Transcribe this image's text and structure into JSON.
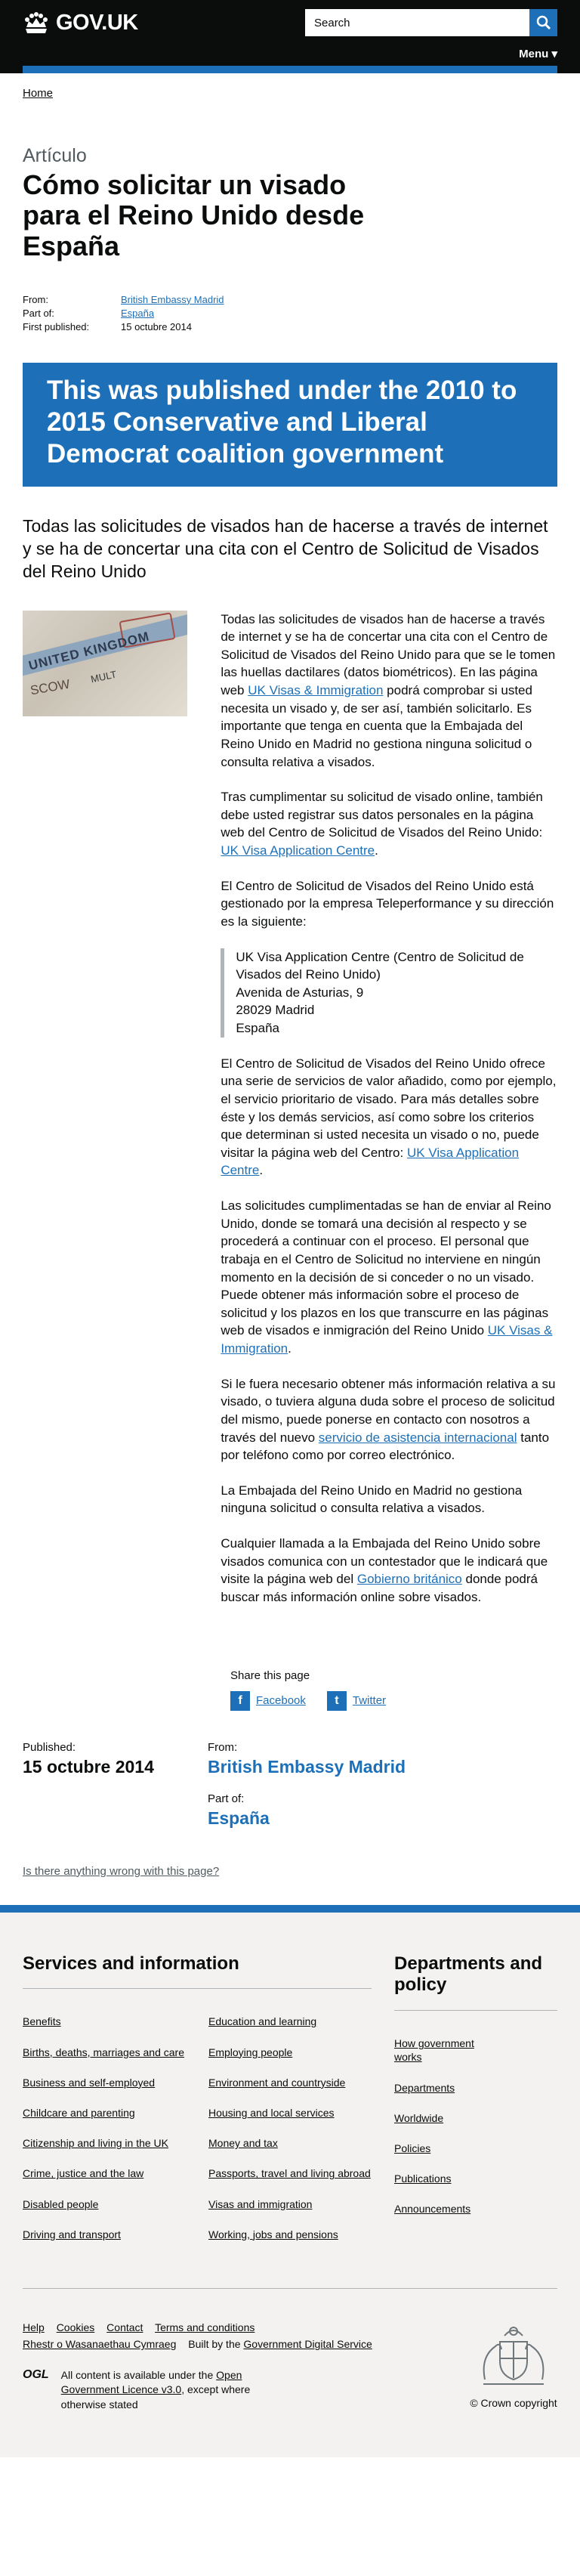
{
  "header": {
    "logo_text": "GOV.UK",
    "search_placeholder": "Search",
    "menu_label": "Menu ▾"
  },
  "breadcrumb": {
    "home": "Home"
  },
  "article": {
    "doc_type": "Artículo",
    "title": "Cómo solicitar un visado para el Reino Unido desde España",
    "meta": {
      "from_label": "From:",
      "from_value": "British Embassy Madrid",
      "partof_label": "Part of:",
      "partof_value": "España",
      "first_label": "First published:",
      "first_value": "15 octubre 2014"
    },
    "history_banner": "This was published under the 2010 to 2015 Conservative and Liberal Democrat coalition government",
    "lede": "Todas las solicitudes de visados han de hacerse a través de internet y se ha de concertar una cita con el Centro de Solicitud de Visados del Reino Unido",
    "image": {
      "line1": "UNITED KINGDOM",
      "line2": "MULT",
      "line3": "SCOW"
    },
    "p1_pre": "Todas las solicitudes de visados han de hacerse a través de internet y se ha de concertar una cita con el Centro de Solicitud de Visados del Reino Unido para que se le tomen las huellas dactilares (datos biométricos). En las página web ",
    "p1_link": "UK Visas & Immigration",
    "p1_post": " podrá comprobar si usted necesita un visado y, de ser así, también solicitarlo. Es importante que tenga en cuenta que la Embajada del Reino Unido en Madrid no gestiona ninguna solicitud o consulta relativa a visados.",
    "p2_pre": "Tras cumplimentar su solicitud de visado online, también debe usted registrar sus datos personales en la página web del Centro de Solicitud de Visados del Reino Unido: ",
    "p2_link": "UK Visa Application Centre",
    "p2_post": ".",
    "p3": "El Centro de Solicitud de Visados del Reino Unido está gestionado por la empresa Teleperformance y su dirección es la siguiente:",
    "address": [
      "UK Visa Application Centre (Centro de Solicitud de Visados del Reino Unido)",
      "Avenida de Asturias, 9",
      "28029 Madrid",
      "España"
    ],
    "p4_pre": "El Centro de Solicitud de Visados del Reino Unido ofrece una serie de servicios de valor añadido, como por ejemplo, el servicio prioritario de visado. Para más detalles sobre éste y los demás servicios, así como sobre los criterios que determinan si usted necesita un visado o no, puede visitar la página web del Centro: ",
    "p4_link": "UK Visa Application Centre",
    "p4_post": ".",
    "p5_pre": "Las solicitudes cumplimentadas se han de enviar al Reino Unido, donde se tomará una decisión al respecto y se procederá a continuar con el proceso. El personal que trabaja en el Centro de Solicitud no interviene en ningún momento en la decisión de si conceder o no un visado. Puede obtener más información sobre el proceso de solicitud y los plazos en los que transcurre en las páginas web de visados e inmigración del Reino Unido ",
    "p5_link": "UK Visas & Immigration",
    "p5_post": ".",
    "p6_pre": "Si le fuera necesario obtener más información relativa a su visado, o tuviera alguna duda sobre el proceso de solicitud del mismo, puede ponerse en contacto con nosotros a través del nuevo ",
    "p6_link": "servicio de asistencia internacional",
    "p6_post": " tanto por teléfono como por correo electrónico.",
    "p7": "La Embajada del Reino Unido en Madrid no gestiona ninguna solicitud o consulta relativa a visados.",
    "p8_pre": "Cualquier llamada a la Embajada del Reino Unido sobre visados comunica con un contestador que le indicará que visite la página web del ",
    "p8_link": "Gobierno británico",
    "p8_post": " donde podrá buscar más información online sobre visados."
  },
  "share": {
    "title": "Share this page",
    "facebook": "Facebook",
    "twitter": "Twitter"
  },
  "published": {
    "label": "Published:",
    "date": "15 octubre 2014",
    "from_label": "From:",
    "from_value": "British Embassy Madrid",
    "partof_label": "Part of:",
    "partof_value": "España"
  },
  "report_link": "Is there anything wrong with this page?",
  "footer": {
    "services_heading": "Services and information",
    "depts_heading": "Departments and policy",
    "col1": [
      "Benefits",
      "Births, deaths, marriages and care",
      "Business and self-employed",
      "Childcare and parenting",
      "Citizenship and living in the UK",
      "Crime, justice and the law",
      "Disabled people",
      "Driving and transport"
    ],
    "col2": [
      "Education and learning",
      "Employing people",
      "Environment and countryside",
      "Housing and local services",
      "Money and tax",
      "Passports, travel and living abroad",
      "Visas and immigration",
      "Working, jobs and pensions"
    ],
    "depts": [
      "How government works",
      "Departments",
      "Worldwide",
      "Policies",
      "Publications",
      "Announcements"
    ],
    "meta_links": [
      "Help",
      "Cookies",
      "Contact",
      "Terms and conditions",
      "Rhestr o Wasanaethau Cymraeg"
    ],
    "built_by_pre": "Built by the ",
    "built_by_link": "Government Digital Service",
    "ogl": "OGL",
    "licence_pre": "All content is available under the ",
    "licence_link": "Open Government Licence v3.0",
    "licence_post": ", except where otherwise stated",
    "copyright": "© Crown copyright"
  }
}
